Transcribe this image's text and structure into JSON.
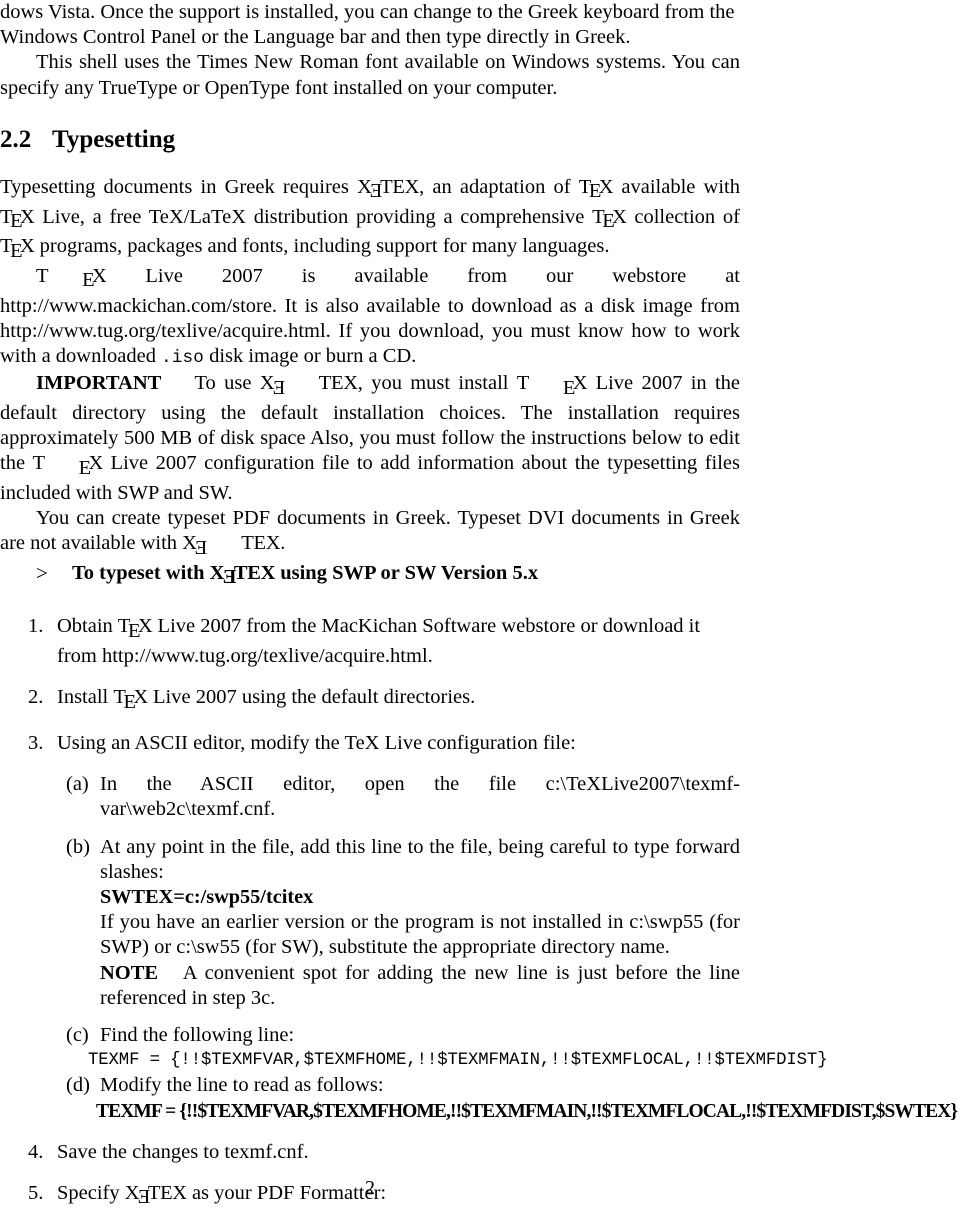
{
  "document": {
    "page_number": "2",
    "intro": {
      "line1": "dows Vista. Once the support is installed, you can change to the Greek keyboard from the",
      "line2": "Windows Control Panel or the Language bar and then type directly in Greek.",
      "para2": "This shell uses the Times New Roman font available on Windows systems. You can specify any TrueType or OpenType font installed on your computer."
    },
    "section": {
      "number": "2.2",
      "title": "Typesetting"
    },
    "paragraphs": {
      "p1_a": "Typesetting documents in Greek requires ",
      "p1_b": ", an adaptation of ",
      "p1_c": " available with ",
      "p1_d": " Live, a free TeX/LaTeX distribution providing a comprehensive ",
      "p1_e": " collection of ",
      "p1_f": " programs, packages and fonts, including support for many languages.",
      "p2_a": " Live 2007 is available from our webstore at http://www.mackichan.com/store. It is also available to download as a disk image from http://www.tug.org/texlive/acquire.html. If you download, you must know how to work with a downloaded ",
      "p2_iso": ".iso",
      "p2_b": " disk image or burn a CD.",
      "p3_label": "IMPORTANT",
      "p3_a": "To use ",
      "p3_b": ", you must install ",
      "p3_c": " Live 2007 in the default directory using the default installation choices. The installation requires approximately 500 MB of disk space Also, you must follow the instructions below to edit the ",
      "p3_d": " Live 2007 configuration file to add information about the typesetting files included with SWP and SW.",
      "p4_a": "You can create typeset PDF documents in Greek. Typeset DVI documents in Greek are not available with ",
      "p4_b": "."
    },
    "procedure_heading": {
      "marker": ">",
      "text_a": "To typeset with ",
      "text_b": " using SWP or SW Version 5.x"
    },
    "steps": [
      {
        "marker": "1.",
        "text_a": "Obtain ",
        "text_b": " Live 2007 from the MacKichan Software webstore or download it from http://www.tug.org/texlive/acquire.html."
      },
      {
        "marker": "2.",
        "text_a": "Install ",
        "text_b": " Live 2007 using the default directories."
      },
      {
        "marker": "3.",
        "text_a": "Using an ASCII editor, modify the TeX Live configuration file:",
        "text_b": ""
      },
      {
        "marker": "4.",
        "text_a": "Save the changes to texmf.cnf.",
        "text_b": ""
      },
      {
        "marker": "5.",
        "text_a": "Specify ",
        "text_b": " as your PDF Formatter:"
      }
    ],
    "substeps": {
      "a": {
        "marker": "(a)",
        "text": "In the ASCII editor, open the file c:\\TeXLive2007\\texmf-var\\web2c\\texmf.cnf."
      },
      "b": {
        "marker": "(b)",
        "text": "At any point in the file, add this line to the file, being careful to type forward slashes:",
        "code": "SWTEX=c:/swp55/tcitex",
        "followup": "If you have an earlier version or the program is not installed in c:\\swp55 (for SWP) or c:\\sw55 (for SW), substitute the appropriate directory name.",
        "note_label": "NOTE",
        "note_text": "A convenient spot for adding the new line is just before the line referenced in step 3c."
      },
      "c": {
        "marker": "(c)",
        "text": "Find the following line:",
        "code": "TEXMF = {!!$TEXMFVAR,$TEXMFHOME,!!$TEXMFMAIN,!!$TEXMFLOCAL,!!$TEXMFDIST}"
      },
      "d": {
        "marker": "(d)",
        "text": "Modify the line to read as follows:",
        "code": "TEXMF = {!!$TEXMFVAR,$TEXMFHOME,!!$TEXMFMAIN,!!$TEXMFLOCAL,!!$TEXMFDIST,$SWTEX}"
      }
    },
    "logos": {
      "tex_t": "T",
      "tex_e": "E",
      "tex_x": "X",
      "xetex_x1": "X",
      "xetex_e_rev": "E",
      "xetex_t": "T",
      "xetex_e": "E",
      "xetex_x2": "X"
    }
  }
}
